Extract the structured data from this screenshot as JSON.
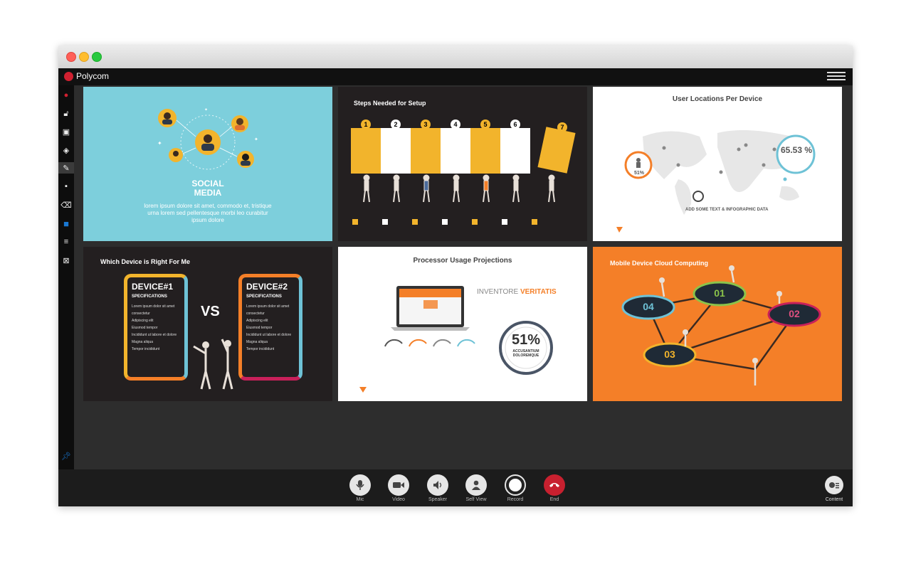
{
  "app": {
    "name": "Polycom"
  },
  "toolbar_items": [
    "polycom-icon",
    "unlock-icon",
    "select-icon",
    "pointer-icon",
    "pen-icon",
    "color-icon",
    "eraser-icon",
    "square-icon",
    "lines-icon",
    "clear-icon",
    "pin-icon"
  ],
  "slides": {
    "social": {
      "title_line1": "SOCIAL",
      "title_line2": "MEDIA",
      "body": "lorem ipsum dolore sit amet, commodo et, tristique urna lorem sed pellentesque morbi leo curabitur ipsum dolore"
    },
    "steps": {
      "title": "Steps Needed for Setup",
      "numbers": [
        "1",
        "2",
        "3",
        "4",
        "5",
        "6",
        "7"
      ]
    },
    "locations": {
      "title": "User Locations Per Device",
      "stat_big": "65.53 %",
      "stat_small": "51%",
      "caption": "ADD SOME TEXT & INFOGRAPHIC DATA"
    },
    "device": {
      "title": "Which Device is Right For Me",
      "device1": "DEVICE#1",
      "device2": "DEVICE#2",
      "spec": "SPECIFICATIONS",
      "vs": "VS",
      "list1": [
        "Lorem ipsum dolor sit amet consectetur",
        "Adipiscing elit",
        "Eiusmod tempor",
        "Incididunt ut labore et dolore",
        "Magna aliqua",
        "Tempor incididunt"
      ],
      "list2": [
        "Lorem ipsum dolor sit amet consectetur",
        "Adipiscing elit",
        "Eiusmod tempor",
        "Incididunt ut labore et dolore",
        "Magna aliqua",
        "Tempor incididunt"
      ]
    },
    "processor": {
      "title": "Processor Usage Projections",
      "brand1": "INVENTORE",
      "brand2": "VERITATIS",
      "stat": "51%",
      "stat_caption": "ACCUSANTIUM DOLOREMQUE"
    },
    "cloud": {
      "title": "Mobile Device Cloud Computing",
      "nodes": [
        "04",
        "01",
        "02",
        "03"
      ]
    }
  },
  "controls": [
    {
      "label": "Mic",
      "icon": "mic-icon"
    },
    {
      "label": "Video",
      "icon": "video-icon"
    },
    {
      "label": "Speaker",
      "icon": "speaker-icon"
    },
    {
      "label": "Self View",
      "icon": "person-icon"
    },
    {
      "label": "Record",
      "icon": "record-icon"
    },
    {
      "label": "End",
      "icon": "end-call-icon"
    }
  ],
  "content": {
    "label": "Content"
  },
  "colors": {
    "teal": "#7dcfdc",
    "orange": "#f47f28",
    "dark": "#231f20",
    "yellow": "#f2b42c",
    "red": "#c8202f"
  }
}
